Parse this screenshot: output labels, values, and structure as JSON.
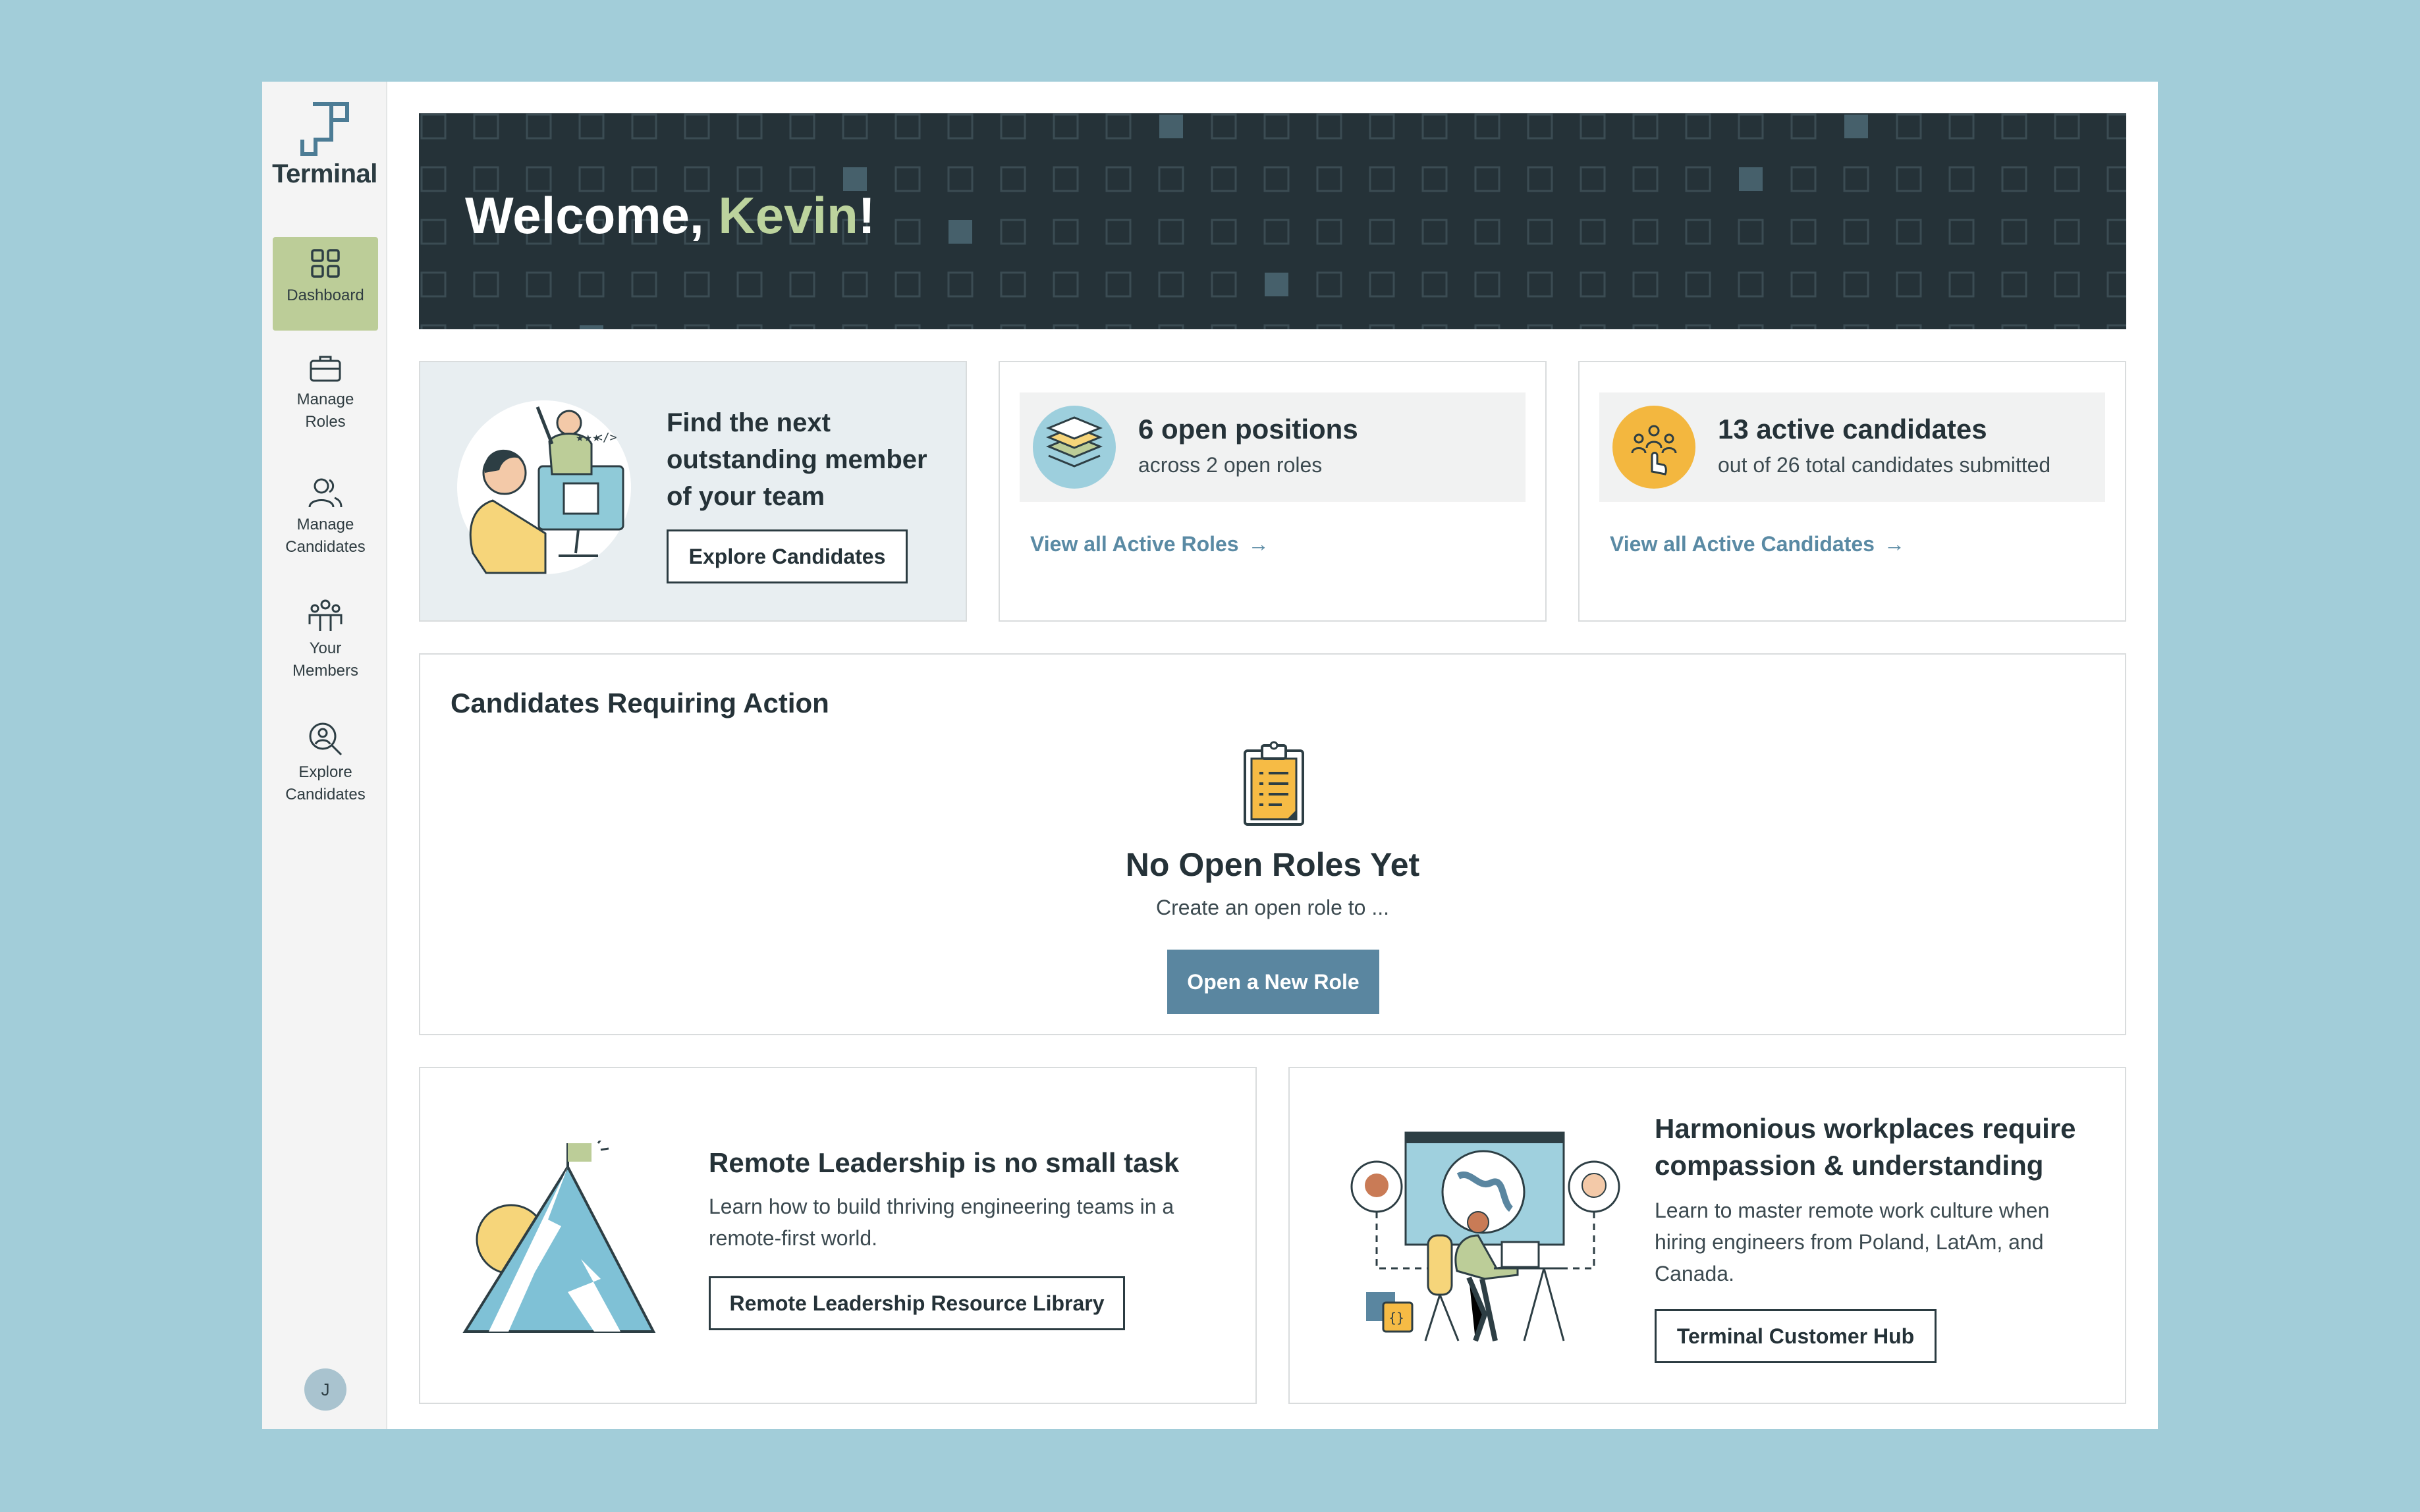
{
  "brand": {
    "name": "Terminal"
  },
  "sidebar": {
    "items": [
      {
        "label": "Dashboard",
        "icon": "grid-icon",
        "active": true
      },
      {
        "label": "Manage Roles",
        "icon": "briefcase-icon",
        "active": false
      },
      {
        "label": "Manage Candidates",
        "icon": "users-icon",
        "active": false
      },
      {
        "label": "Your Members",
        "icon": "team-icon",
        "active": false
      },
      {
        "label": "Explore Candidates",
        "icon": "search-person-icon",
        "active": false
      }
    ],
    "avatar_initial": "J"
  },
  "banner": {
    "greeting": "Welcome, ",
    "name": "Kevin",
    "suffix": "!"
  },
  "promo": {
    "title": "Find the next outstanding member of your team",
    "button": "Explore Candidates"
  },
  "positions": {
    "title": "6 open positions",
    "subtitle": "across 2 open roles",
    "link": "View all Active Roles",
    "icon": "layers-icon"
  },
  "candidates": {
    "title": "13 active candidates",
    "subtitle": "out of 26 total candidates submitted",
    "link": "View all Active Candidates",
    "icon": "people-pointer-icon"
  },
  "action": {
    "section_title": "Candidates Requiring Action",
    "empty_title": "No Open Roles Yet",
    "empty_subtitle": "Create an open role to ...",
    "button": "Open a New Role"
  },
  "resource_left": {
    "title": "Remote Leadership is no small task",
    "body": "Learn how to build thriving engineering teams in a remote-first world.",
    "button": "Remote Leadership Resource Library"
  },
  "resource_right": {
    "title": "Harmonious workplaces require compassion & understanding",
    "body": "Learn to master remote work culture when hiring engineers from Poland, LatAm, and Canada.",
    "button": "Terminal Customer Hub"
  },
  "colors": {
    "background": "#a2cdd9",
    "banner": "#253238",
    "accent_green": "#bccd98",
    "accent_blue": "#5a86a0",
    "name_highlight": "#bcd39d"
  }
}
